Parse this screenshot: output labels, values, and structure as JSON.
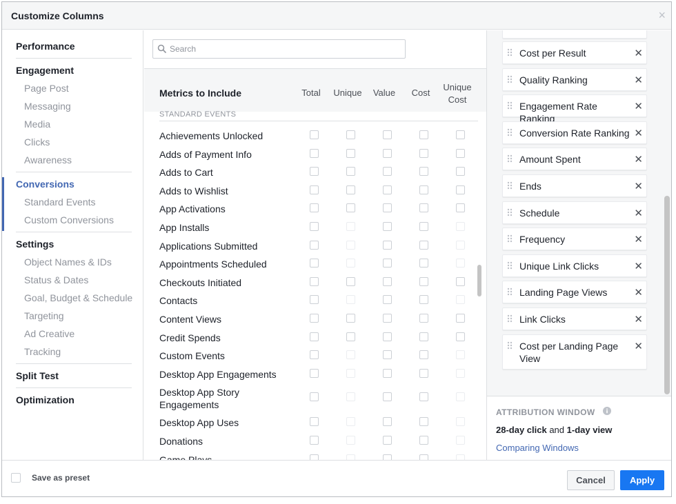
{
  "dialog": {
    "title": "Customize Columns",
    "close_glyph": "×"
  },
  "nav": {
    "groups": [
      {
        "label": "Performance",
        "items": []
      },
      {
        "label": "Engagement",
        "items": [
          "Page Post",
          "Messaging",
          "Media",
          "Clicks",
          "Awareness"
        ]
      },
      {
        "label": "Conversions",
        "items": [
          "Standard Events",
          "Custom Conversions"
        ]
      },
      {
        "label": "Settings",
        "items": [
          "Object Names & IDs",
          "Status & Dates",
          "Goal, Budget & Schedule",
          "Targeting",
          "Ad Creative",
          "Tracking"
        ]
      },
      {
        "label": "Split Test",
        "items": []
      },
      {
        "label": "Optimization",
        "items": []
      }
    ],
    "active_group": "Conversions"
  },
  "search": {
    "placeholder": "Search",
    "value": ""
  },
  "metrics": {
    "title": "Metrics to Include",
    "columns": [
      "Total",
      "Unique",
      "Value",
      "Cost",
      "Unique Cost"
    ],
    "section_label": "STANDARD EVENTS",
    "rows": [
      {
        "label": "Achievements Unlocked",
        "enabled": [
          true,
          true,
          true,
          true,
          true
        ]
      },
      {
        "label": "Adds of Payment Info",
        "enabled": [
          true,
          true,
          true,
          true,
          true
        ]
      },
      {
        "label": "Adds to Cart",
        "enabled": [
          true,
          true,
          true,
          true,
          true
        ]
      },
      {
        "label": "Adds to Wishlist",
        "enabled": [
          true,
          true,
          true,
          true,
          true
        ]
      },
      {
        "label": "App Activations",
        "enabled": [
          true,
          true,
          true,
          true,
          true
        ]
      },
      {
        "label": "App Installs",
        "enabled": [
          true,
          false,
          true,
          true,
          false
        ]
      },
      {
        "label": "Applications Submitted",
        "enabled": [
          true,
          false,
          true,
          true,
          false
        ]
      },
      {
        "label": "Appointments Scheduled",
        "enabled": [
          true,
          false,
          true,
          true,
          false
        ]
      },
      {
        "label": "Checkouts Initiated",
        "enabled": [
          true,
          true,
          true,
          true,
          true
        ]
      },
      {
        "label": "Contacts",
        "enabled": [
          true,
          false,
          true,
          true,
          false
        ]
      },
      {
        "label": "Content Views",
        "enabled": [
          true,
          true,
          true,
          true,
          true
        ]
      },
      {
        "label": "Credit Spends",
        "enabled": [
          true,
          true,
          true,
          true,
          true
        ]
      },
      {
        "label": "Custom Events",
        "enabled": [
          true,
          false,
          true,
          true,
          false
        ]
      },
      {
        "label": "Desktop App Engagements",
        "enabled": [
          true,
          false,
          true,
          true,
          false
        ]
      },
      {
        "label": "Desktop App Story Engagements",
        "enabled": [
          true,
          false,
          true,
          true,
          false
        ]
      },
      {
        "label": "Desktop App Uses",
        "enabled": [
          true,
          false,
          true,
          true,
          false
        ]
      },
      {
        "label": "Donations",
        "enabled": [
          true,
          false,
          true,
          true,
          false
        ]
      },
      {
        "label": "Game Plays",
        "enabled": [
          true,
          false,
          true,
          true,
          false
        ]
      }
    ]
  },
  "selected_columns": [
    "Cost per Result",
    "Quality Ranking",
    "Engagement Rate Ranking",
    "Conversion Rate Ranking",
    "Amount Spent",
    "Ends",
    "Schedule",
    "Frequency",
    "Unique Link Clicks",
    "Landing Page Views",
    "Link Clicks",
    "Cost per Landing Page View"
  ],
  "attribution": {
    "title": "ATTRIBUTION WINDOW",
    "click": "28-day click",
    "joiner": " and ",
    "view": "1-day view",
    "link": "Comparing Windows"
  },
  "footer": {
    "preset_label": "Save as preset",
    "cancel": "Cancel",
    "apply": "Apply"
  },
  "colors": {
    "accent": "#4267b2",
    "apply": "#1877f2",
    "muted": "#90949c"
  }
}
